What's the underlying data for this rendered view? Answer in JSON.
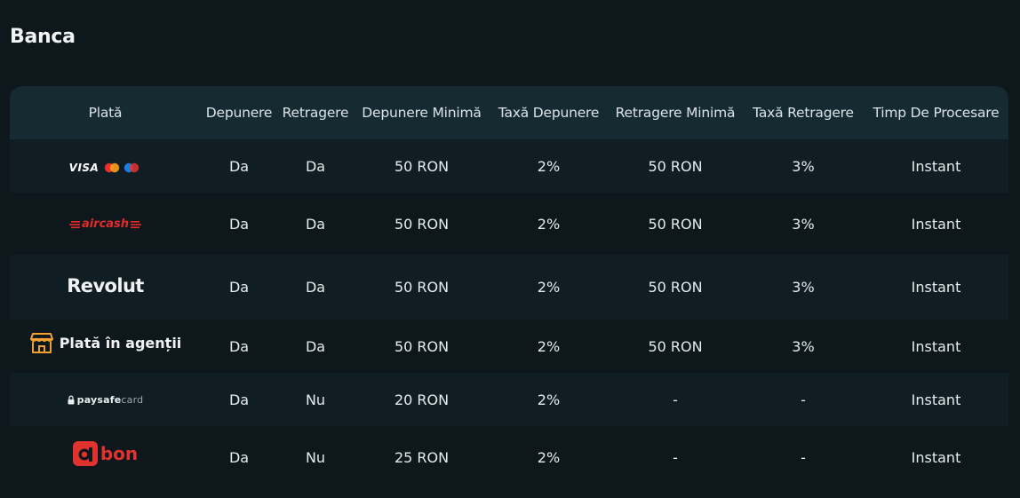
{
  "page_title": "Banca",
  "columns": [
    "Plată",
    "Depunere",
    "Retragere",
    "Depunere Minimă",
    "Taxă Depunere",
    "Retragere Minimă",
    "Taxă Retragere",
    "Timp De Procesare"
  ],
  "rows": [
    {
      "method": "VISA",
      "logo_icon": "visa-mastercard-maestro-logo",
      "depunere": "Da",
      "retragere": "Da",
      "depunere_minima": "50 RON",
      "taxa_depunere": "2%",
      "retragere_minima": "50 RON",
      "taxa_retragere": "3%",
      "timp": "Instant"
    },
    {
      "method": "aircash",
      "logo_icon": "aircash-logo",
      "depunere": "Da",
      "retragere": "Da",
      "depunere_minima": "50 RON",
      "taxa_depunere": "2%",
      "retragere_minima": "50 RON",
      "taxa_retragere": "3%",
      "timp": "Instant"
    },
    {
      "method": "Revolut",
      "logo_icon": "revolut-logo",
      "depunere": "Da",
      "retragere": "Da",
      "depunere_minima": "50 RON",
      "taxa_depunere": "2%",
      "retragere_minima": "50 RON",
      "taxa_retragere": "3%",
      "timp": "Instant"
    },
    {
      "method": "Plată în agenții",
      "logo_icon": "store-icon",
      "depunere": "Da",
      "retragere": "Da",
      "depunere_minima": "50 RON",
      "taxa_depunere": "2%",
      "retragere_minima": "50 RON",
      "taxa_retragere": "3%",
      "timp": "Instant"
    },
    {
      "method_bold": "paysafe",
      "method_light": "card",
      "logo_icon": "paysafecard-logo",
      "depunere": "Da",
      "retragere": "Nu",
      "depunere_minima": "20 RON",
      "taxa_depunere": "2%",
      "retragere_minima": "-",
      "taxa_retragere": "-",
      "timp": "Instant"
    },
    {
      "method": "bon",
      "logo_icon": "abon-logo",
      "depunere": "Da",
      "retragere": "Nu",
      "depunere_minima": "25 RON",
      "taxa_depunere": "2%",
      "retragere_minima": "-",
      "taxa_retragere": "-",
      "timp": "Instant"
    }
  ],
  "colors": {
    "background": "#0e171c",
    "header_bg": "#162a31",
    "row_alt_bg": "#101e24",
    "aircash_red": "#e12b2b",
    "abon_red": "#e1332d",
    "agency_orange": "#f0a030"
  }
}
